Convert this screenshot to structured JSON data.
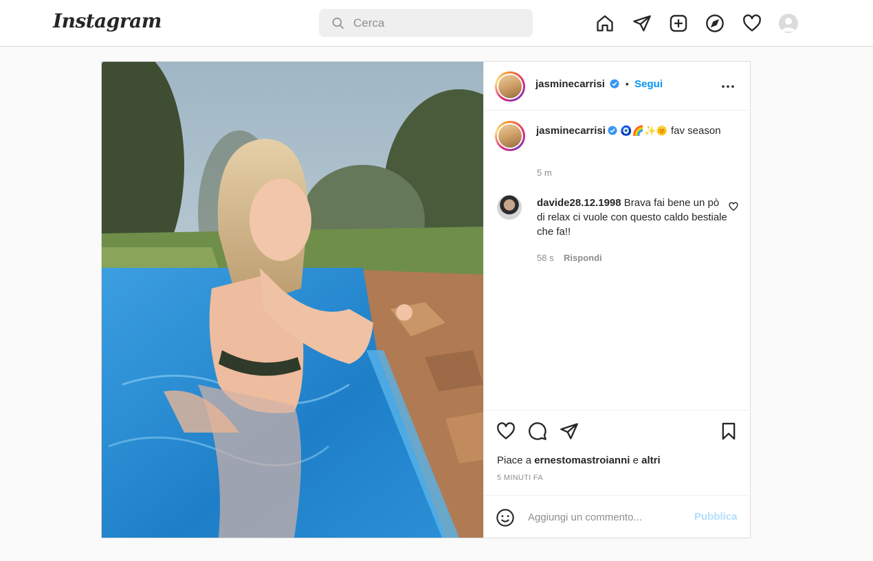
{
  "header": {
    "logo": "Instagram",
    "search": {
      "placeholder": "Cerca",
      "value": ""
    },
    "nav_icons": [
      "home-icon",
      "direct-icon",
      "new-post-icon",
      "explore-icon",
      "activity-icon",
      "profile-avatar"
    ]
  },
  "post": {
    "author": {
      "username": "jasminecarrisi",
      "verified": true,
      "follow_label": "Segui",
      "separator": "•"
    },
    "caption": {
      "username": "jasminecarrisi",
      "emojis": "🧿🌈✨🌞",
      "text": "fav season",
      "age": "5 m"
    },
    "comments": [
      {
        "username": "davide28.12.1998",
        "text": "Brava fai bene un pò di relax ci vuole con questo caldo bestiale che fa!!",
        "age": "58 s",
        "reply_label": "Rispondi"
      }
    ],
    "likes": {
      "prefix": "Piace a",
      "user": "ernestomastroianni",
      "connector": "e",
      "others": "altri"
    },
    "timestamp": "5 MINUTI FA",
    "add_comment": {
      "placeholder": "Aggiungi un commento...",
      "publish_label": "Pubblica"
    }
  },
  "colors": {
    "accent": "#0095f6",
    "publish_disabled": "#b2dffc",
    "border": "#dbdbdb",
    "background": "#fafafa"
  }
}
